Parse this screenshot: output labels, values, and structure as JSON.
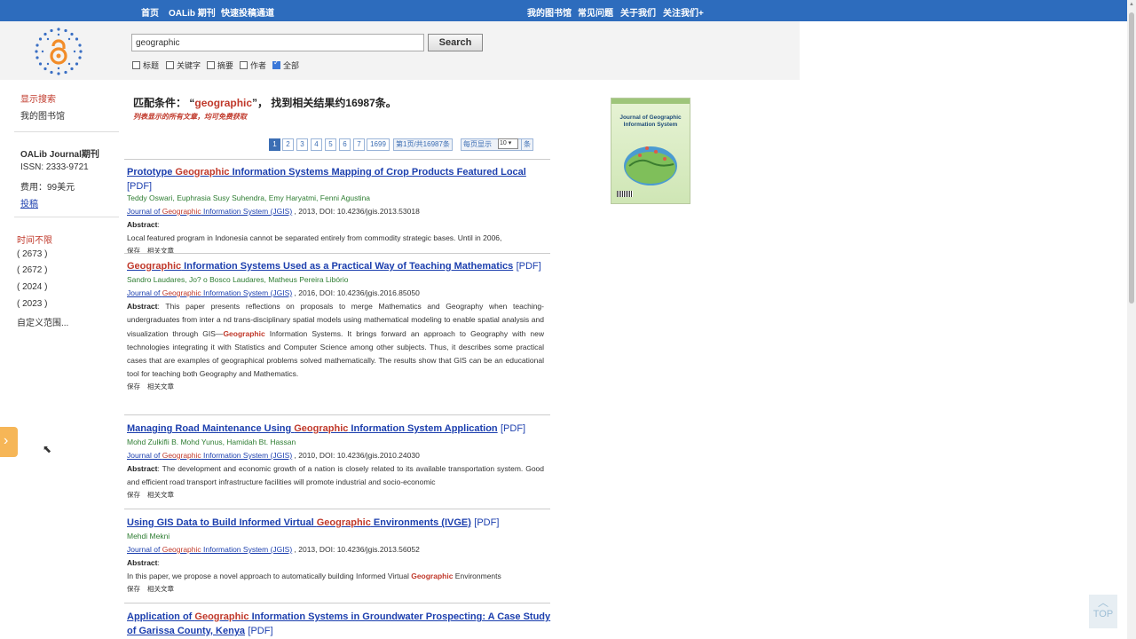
{
  "nav": {
    "left": [
      "首页",
      "OALib 期刊",
      "快速投稿通道"
    ],
    "right": [
      "我的图书馆",
      "常见问题",
      "关于我们",
      "关注我们+"
    ]
  },
  "search": {
    "value": "geographic",
    "button": "Search",
    "options": [
      {
        "label": "标题",
        "checked": false
      },
      {
        "label": "关键字",
        "checked": false
      },
      {
        "label": "摘要",
        "checked": false
      },
      {
        "label": "作者",
        "checked": false
      },
      {
        "label": "全部",
        "checked": true
      }
    ]
  },
  "sidebar": {
    "show_search": "显示搜索",
    "my_library": "我的图书馆",
    "journal_title": "OALib Journal期刊",
    "issn": "ISSN: 2333-9721",
    "fee": "费用：99美元",
    "submit": "投稿",
    "time_header": "时间不限",
    "years": [
      "( 2673 )",
      "( 2672 )",
      "( 2024 )",
      "( 2023 )"
    ],
    "custom_range": "自定义范围..."
  },
  "main": {
    "match_prefix": "匹配条件：",
    "match_open": "“",
    "query": "geographic",
    "match_close": "”，",
    "match_suffix": "找到相关结果约16987条。",
    "hint": "列表显示的所有文章，均可免费获取"
  },
  "pager": {
    "pages": [
      "1",
      "2",
      "3",
      "4",
      "5",
      "6",
      "7",
      "1699"
    ],
    "current": "1",
    "summary": "第1页/共16987条",
    "per_page_label": "每页显示",
    "per_page_value": "10",
    "unit": "条"
  },
  "labels": {
    "pdf": "[PDF]",
    "abstract": "Abstract",
    "save": "保存",
    "related": "相关文章"
  },
  "results": [
    {
      "title_parts": [
        "Prototype ",
        "Geographic",
        " Information Systems Mapping of Crop Products Featured Local"
      ],
      "authors": "Teddy Oswari, Euphrasia Susy Suhendra, Emy Haryatmi, Fenni Agustina",
      "journal_parts": [
        "Journal of ",
        "Geographic",
        " Information System (JGIS)"
      ],
      "meta": " , 2013, DOI: 10.4236/jgis.2013.53018",
      "abstract_parts": [
        "Local featured program in Indonesia cannot be separated entirely from commodity strategic bases. Until in 2006,"
      ],
      "abstract_inline": false
    },
    {
      "title_parts": [
        "Geographic",
        " Information Systems Used as a Practical Way of Teaching Mathematics"
      ],
      "authors": "Sandro Laudares, Jo? o Bosco Laudares, Matheus Pereira Libório",
      "journal_parts": [
        "Journal of ",
        "Geographic",
        " Information System (JGIS)"
      ],
      "meta": " , 2016, DOI: 10.4236/jgis.2016.85050",
      "abstract_parts": [
        "This paper presents reflections on proposals to merge Mathematics and Geography when teaching-undergraduates from inter                                                                                                    a nd trans-disciplinary spatial models using mathematical modeling to enable spatial analysis and visualization through GIS—",
        "Geographic",
        " Information Systems. It brings forward an approach to Geography with new technologies integrating it with Statistics and Computer Science among other subjects. Thus, it describes some practical cases that are examples of geographical problems solved mathematically. The results show that GIS can be an educational tool for teaching both Geography and Mathematics."
      ],
      "abstract_inline": true
    },
    {
      "title_parts": [
        "Managing Road Maintenance Using ",
        "Geographic",
        " Information System Application"
      ],
      "authors": "Mohd Zulkifli B. Mohd Yunus, Hamidah Bt. Hassan",
      "journal_parts": [
        "Journal of ",
        "Geographic",
        " Information System (JGIS)"
      ],
      "meta": " , 2010, DOI: 10.4236/jgis.2010.24030",
      "abstract_parts": [
        "The development and economic growth of a nation is closely related to its available transportation system. Good and efficient road transport infrastructure facilities will promote industrial and socio-economic"
      ],
      "abstract_inline": true
    },
    {
      "title_parts": [
        "Using GIS Data to Build Informed Virtual ",
        "Geographic",
        " Environments (IVGE)"
      ],
      "authors": "Mehdi Mekni",
      "journal_parts": [
        "Journal of ",
        "Geographic",
        " Information System (JGIS)"
      ],
      "meta": " , 2013, DOI: 10.4236/jgis.2013.56052",
      "abstract_parts": [
        "In this paper, we propose a novel approach to automatically building Informed Virtual ",
        "Geographic",
        " Environments"
      ],
      "abstract_inline": false
    },
    {
      "title_parts": [
        "Application of ",
        "Geographic",
        " Information Systems in Groundwater Prospecting: A Case Study of Garissa County, Kenya"
      ],
      "authors": "",
      "journal_parts": [],
      "meta": "",
      "abstract_parts": [],
      "abstract_inline": false
    }
  ],
  "cover": {
    "title": "Journal of Geographic Information System"
  },
  "top_button": "TOP",
  "colors": {
    "nav": "#2d6cbd",
    "link": "#1c3fae",
    "highlight": "#c0392b",
    "authors": "#2e7d32"
  }
}
